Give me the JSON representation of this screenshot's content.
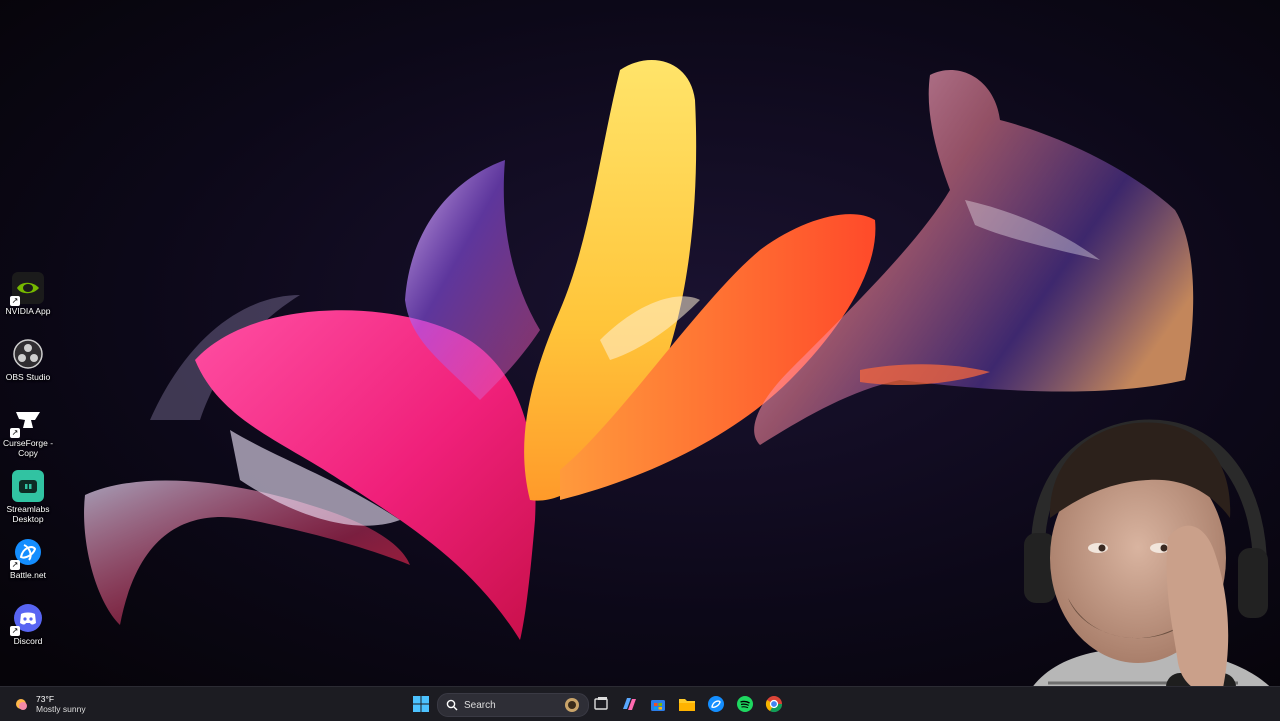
{
  "desktop": {
    "icons": [
      {
        "id": "nvidia",
        "label": "NVIDIA App",
        "icon": "nvidia-icon",
        "color": "#76b900"
      },
      {
        "id": "obs",
        "label": "OBS Studio",
        "icon": "obs-icon",
        "color": "#302e31"
      },
      {
        "id": "curseforge",
        "label": "CurseForge - Copy",
        "icon": "curseforge-icon",
        "color": "#f16436"
      },
      {
        "id": "streamlabs",
        "label": "Streamlabs Desktop",
        "icon": "streamlabs-icon",
        "color": "#31c3a2"
      },
      {
        "id": "battlenet",
        "label": "Battle.net",
        "icon": "battlenet-icon",
        "color": "#148eff"
      },
      {
        "id": "discord",
        "label": "Discord",
        "icon": "discord-icon",
        "color": "#5865f2"
      }
    ]
  },
  "taskbar": {
    "weather": {
      "temp": "73°F",
      "desc": "Mostly sunny",
      "icon": "weather-sun-icon"
    },
    "search": {
      "label": "Search",
      "icon": "search-icon"
    },
    "apps": [
      {
        "id": "task-view",
        "icon": "task-view-icon"
      },
      {
        "id": "copilot",
        "icon": "copilot-icon"
      },
      {
        "id": "store",
        "icon": "store-icon"
      },
      {
        "id": "file-explorer",
        "icon": "folder-icon"
      },
      {
        "id": "battlenet-tb",
        "icon": "battlenet-icon"
      },
      {
        "id": "spotify",
        "icon": "spotify-icon"
      },
      {
        "id": "chrome",
        "icon": "chrome-icon"
      }
    ]
  }
}
